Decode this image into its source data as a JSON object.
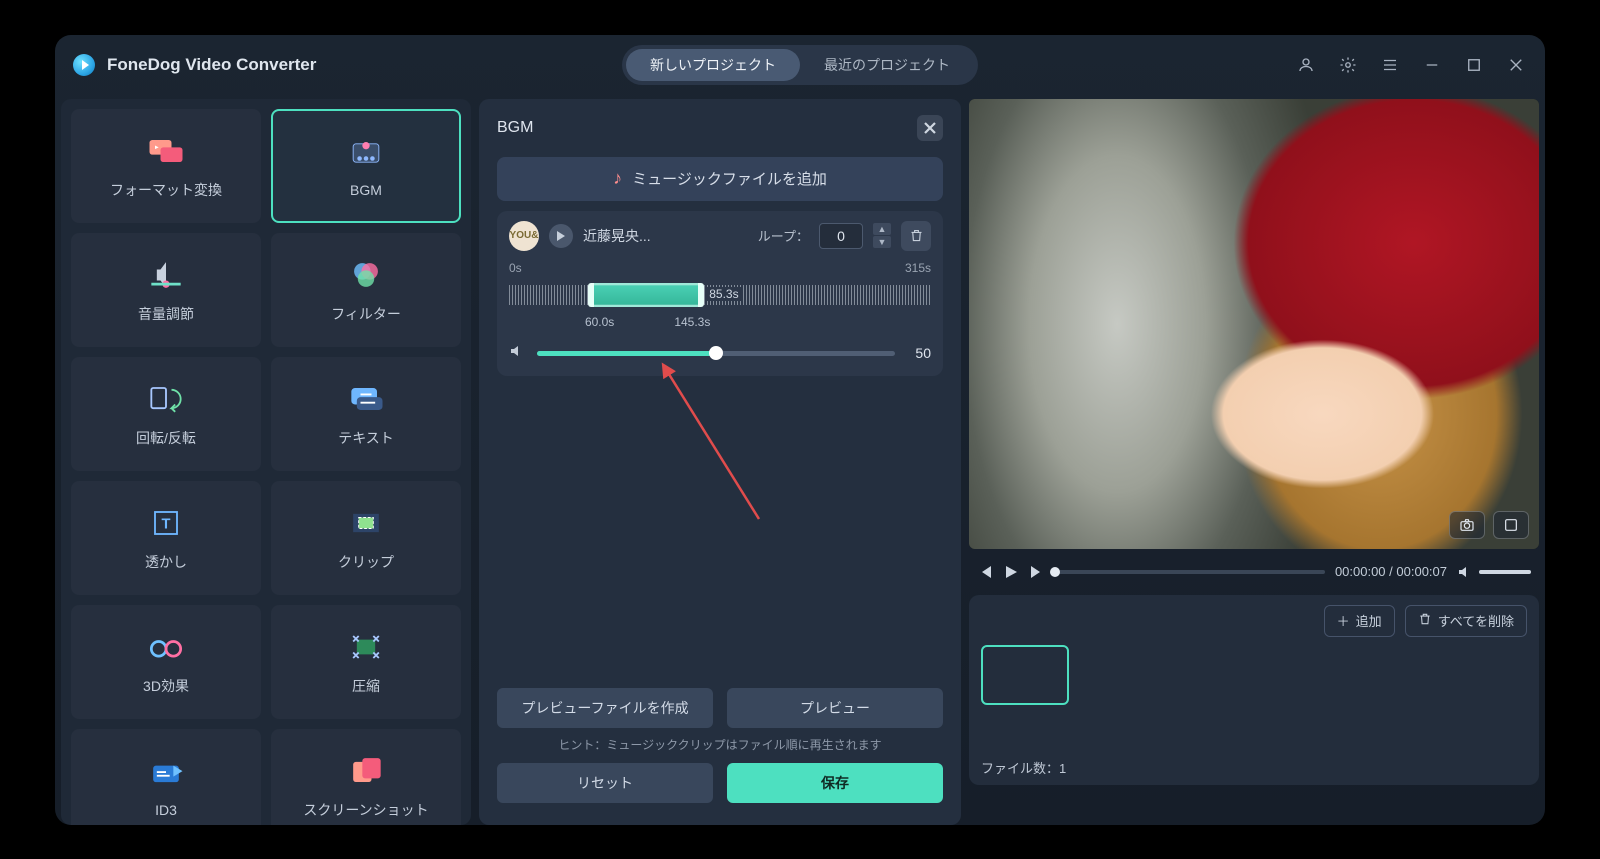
{
  "app": {
    "name": "FoneDog Video Converter"
  },
  "tabs": {
    "new_project": "新しいプロジェクト",
    "recent_projects": "最近のプロジェクト",
    "active_index": 0
  },
  "sidebar": {
    "items": [
      {
        "id": "format",
        "label": "フォーマット変換"
      },
      {
        "id": "bgm",
        "label": "BGM"
      },
      {
        "id": "volume",
        "label": "音量調節"
      },
      {
        "id": "filter",
        "label": "フィルター"
      },
      {
        "id": "rotate",
        "label": "回転/反転"
      },
      {
        "id": "text",
        "label": "テキスト"
      },
      {
        "id": "watermark",
        "label": "透かし"
      },
      {
        "id": "clip",
        "label": "クリップ"
      },
      {
        "id": "3d",
        "label": "3D効果"
      },
      {
        "id": "compress",
        "label": "圧縮"
      },
      {
        "id": "id3",
        "label": "ID3"
      },
      {
        "id": "screenshot",
        "label": "スクリーンショット"
      }
    ],
    "selected_index": 1
  },
  "bgm": {
    "title": "BGM",
    "add_label": "ミュージックファイルを追加",
    "track": {
      "thumb_text": "YOU&",
      "name": "近藤晃央...",
      "loop_label": "ループ：",
      "loop_value": "0",
      "duration_start": "0s",
      "duration_end": "315s",
      "sel_start": "60.0s",
      "sel_end": "145.3s",
      "sel_len": "85.3s",
      "volume": "50"
    },
    "hint": "ヒント：ミュージッククリップはファイル順に再生されます",
    "buttons": {
      "create_preview": "プレビューファイルを作成",
      "preview": "プレビュー",
      "reset": "リセット",
      "save": "保存"
    }
  },
  "preview": {
    "time_current": "00:00:00",
    "time_total": "00:00:07"
  },
  "clips": {
    "add": "追加",
    "delete_all": "すべてを削除",
    "file_count_label": "ファイル数：",
    "file_count": "1"
  }
}
